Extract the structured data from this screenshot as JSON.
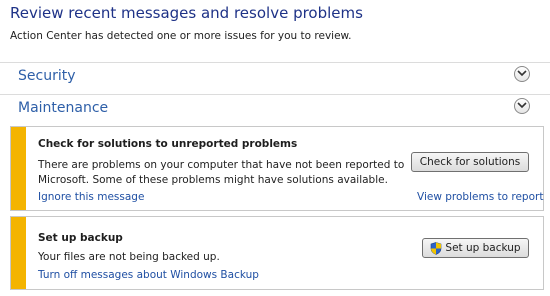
{
  "header": {
    "title": "Review recent messages and resolve problems",
    "subtitle": "Action Center has detected one or more issues for you to review."
  },
  "sections": {
    "security": {
      "label": "Security"
    },
    "maintenance": {
      "label": "Maintenance"
    }
  },
  "messages": [
    {
      "title": "Check for solutions to unreported problems",
      "body_line1": "There are problems on your computer that have not been reported to",
      "body_line2": "Microsoft. Some of these problems might have solutions available.",
      "button_label": "Check for solutions",
      "left_link": "Ignore this message",
      "right_link": "View problems to report"
    },
    {
      "title": "Set up backup",
      "body_line1": "Your files are not being backed up.",
      "button_label": "Set up backup",
      "button_icon": "uac-shield-icon",
      "left_link": "Turn off messages about Windows Backup"
    }
  ],
  "colors": {
    "title": "#1e3287",
    "section": "#2e5fa8",
    "link": "#1f4fa3",
    "stripe": "#f4b400"
  }
}
